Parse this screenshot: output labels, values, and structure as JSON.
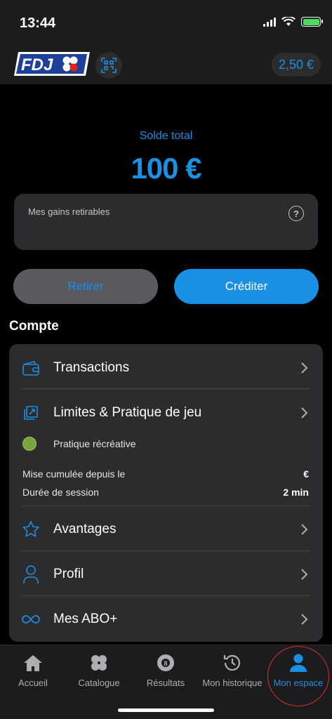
{
  "status_bar": {
    "time": "13:44"
  },
  "header": {
    "logo_text": "FDJ",
    "balance": "2,50 €"
  },
  "balance": {
    "label": "Solde total",
    "value": "100 €"
  },
  "gains": {
    "label": "Mes gains retirables",
    "help": "?"
  },
  "actions": {
    "retirer": "Retirer",
    "crediter": "Créditer"
  },
  "compte": {
    "title": "Compte",
    "transactions": "Transactions",
    "limites": "Limites & Pratique de jeu",
    "pratique": "Pratique récréative",
    "mise_label": "Mise cumulée depuis le",
    "mise_value": "€",
    "duree_label": "Durée de session",
    "duree_value": "2 min",
    "avantages": "Avantages",
    "profil": "Profil",
    "abo": "Mes ABO+"
  },
  "tabs": [
    {
      "label": "Accueil",
      "icon": "home-icon"
    },
    {
      "label": "Catalogue",
      "icon": "clover-icon"
    },
    {
      "label": "Résultats",
      "icon": "ball-icon"
    },
    {
      "label": "Mon historique",
      "icon": "history-icon"
    },
    {
      "label": "Mon espace",
      "icon": "user-icon"
    }
  ],
  "colors": {
    "accent": "#1a8fe3",
    "card": "#2c2c2e",
    "pratique_dot": "#79a33b",
    "highlight": "#d9302c"
  }
}
